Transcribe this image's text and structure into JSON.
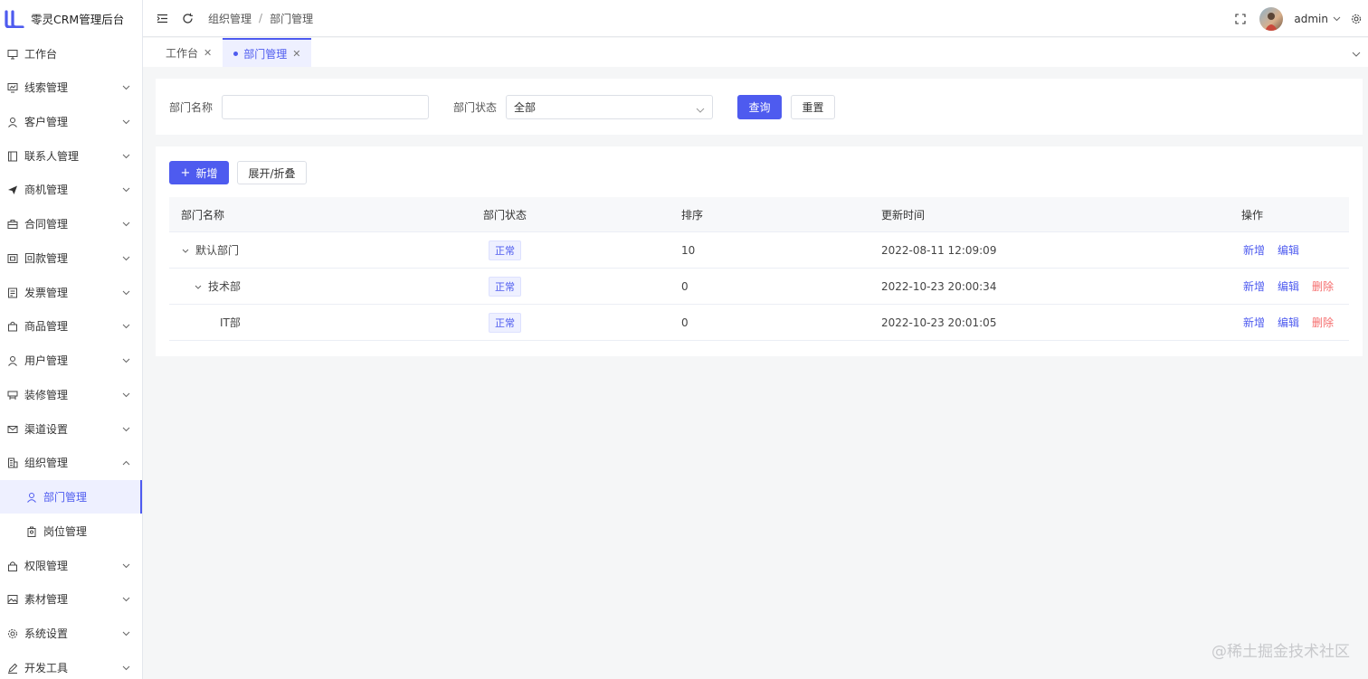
{
  "app": {
    "title": "零灵CRM管理后台"
  },
  "sidebar": {
    "items": [
      {
        "label": "工作台",
        "icon": "monitor-icon"
      },
      {
        "label": "线索管理",
        "icon": "clue-icon"
      },
      {
        "label": "客户管理",
        "icon": "user-icon"
      },
      {
        "label": "联系人管理",
        "icon": "contact-book-icon"
      },
      {
        "label": "商机管理",
        "icon": "send-icon"
      },
      {
        "label": "合同管理",
        "icon": "briefcase-icon"
      },
      {
        "label": "回款管理",
        "icon": "payment-icon"
      },
      {
        "label": "发票管理",
        "icon": "invoice-icon"
      },
      {
        "label": "商品管理",
        "icon": "bag-icon"
      },
      {
        "label": "用户管理",
        "icon": "user-icon"
      },
      {
        "label": "装修管理",
        "icon": "decorate-icon"
      },
      {
        "label": "渠道设置",
        "icon": "mail-icon"
      },
      {
        "label": "组织管理",
        "icon": "building-icon"
      },
      {
        "label": "部门管理",
        "icon": "user-icon"
      },
      {
        "label": "岗位管理",
        "icon": "badge-icon"
      },
      {
        "label": "权限管理",
        "icon": "lock-icon"
      },
      {
        "label": "素材管理",
        "icon": "image-icon"
      },
      {
        "label": "系统设置",
        "icon": "gear-icon"
      },
      {
        "label": "开发工具",
        "icon": "pen-icon"
      }
    ]
  },
  "header": {
    "breadcrumb": [
      "组织管理",
      "部门管理"
    ],
    "username": "admin"
  },
  "tabs": [
    {
      "label": "工作台"
    },
    {
      "label": "部门管理"
    }
  ],
  "search": {
    "name_label": "部门名称",
    "name_value": "",
    "status_label": "部门状态",
    "status_value": "全部",
    "query_button": "查询",
    "reset_button": "重置"
  },
  "toolbar": {
    "add_button": "新增",
    "toggle_button": "展开/折叠"
  },
  "table": {
    "columns": [
      "部门名称",
      "部门状态",
      "排序",
      "更新时间",
      "操作"
    ],
    "rows": [
      {
        "name": "默认部门",
        "status": "正常",
        "sort": "10",
        "updated": "2022-08-11 12:09:09",
        "actions": [
          "新增",
          "编辑"
        ]
      },
      {
        "name": "技术部",
        "status": "正常",
        "sort": "0",
        "updated": "2022-10-23 20:00:34",
        "actions": [
          "新增",
          "编辑",
          "删除"
        ]
      },
      {
        "name": "IT部",
        "status": "正常",
        "sort": "0",
        "updated": "2022-10-23 20:01:05",
        "actions": [
          "新增",
          "编辑",
          "删除"
        ]
      }
    ]
  },
  "watermark": "@稀土掘金技术社区",
  "colors": {
    "primary": "#4e5bef",
    "danger": "#f56c6c"
  }
}
